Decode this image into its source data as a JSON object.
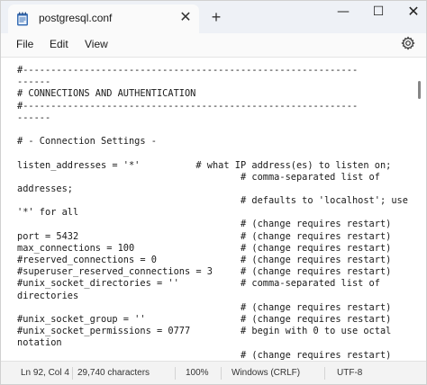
{
  "tab": {
    "title": "postgresql.conf",
    "icon": "notepad-file-icon",
    "close_glyph": "✕",
    "new_tab_glyph": "+"
  },
  "window_controls": {
    "minimize_glyph": "—",
    "maximize_glyph": "☐",
    "close_glyph": "✕"
  },
  "menu": {
    "file": "File",
    "edit": "Edit",
    "view": "View",
    "settings_icon": "gear-icon"
  },
  "editor": {
    "lines": [
      "#------------------------------------------------------------",
      "------",
      "# CONNECTIONS AND AUTHENTICATION",
      "#------------------------------------------------------------",
      "------",
      "",
      "# - Connection Settings -",
      "",
      "listen_addresses = '*'          # what IP address(es) to listen on;",
      "                                        # comma-separated list of",
      "addresses;",
      "                                        # defaults to 'localhost'; use",
      "'*' for all",
      "                                        # (change requires restart)",
      "port = 5432                             # (change requires restart)",
      "max_connections = 100                   # (change requires restart)",
      "#reserved_connections = 0               # (change requires restart)",
      "#superuser_reserved_connections = 3     # (change requires restart)",
      "#unix_socket_directories = ''           # comma-separated list of",
      "directories",
      "                                        # (change requires restart)",
      "#unix_socket_group = ''                 # (change requires restart)",
      "#unix_socket_permissions = 0777         # begin with 0 to use octal",
      "notation",
      "                                        # (change requires restart)"
    ]
  },
  "status": {
    "position": "Ln 92, Col 4",
    "characters": "29,740 characters",
    "zoom": "100%",
    "line_ending": "Windows (CRLF)",
    "encoding": "UTF-8"
  }
}
